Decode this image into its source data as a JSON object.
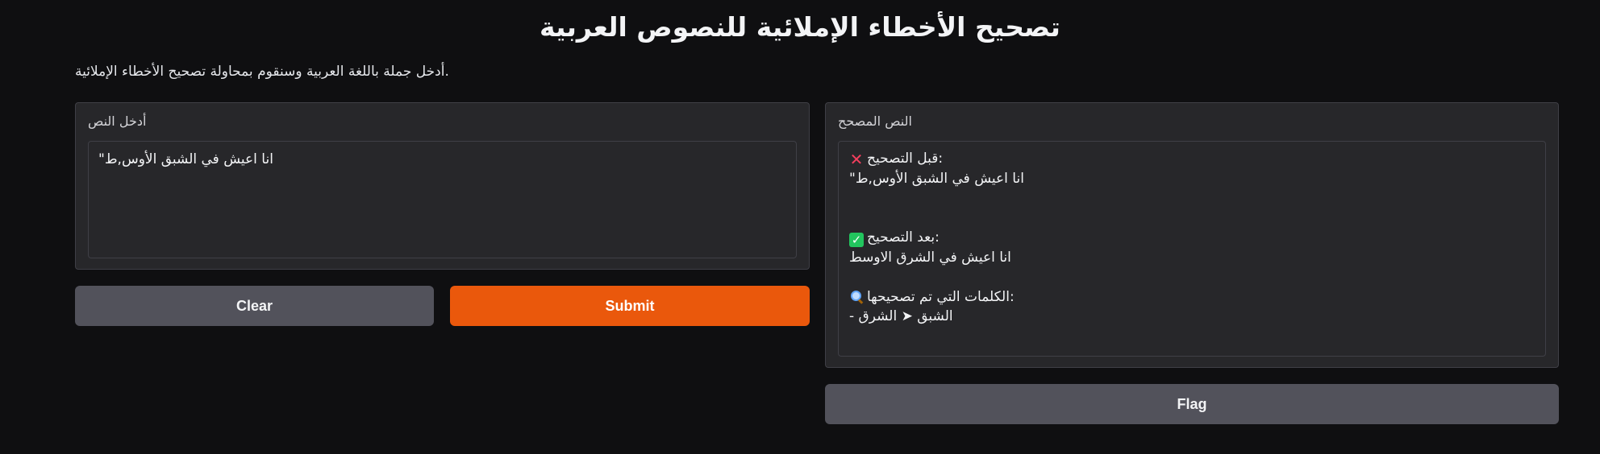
{
  "header": {
    "title": "تصحيح الأخطاء الإملائية للنصوص العربية",
    "description": "أدخل جملة باللغة العربية وسنقوم بمحاولة تصحيح الأخطاء الإملائية."
  },
  "input_panel": {
    "label": "أدخل النص",
    "value": "\"انا اعيش في الشبق الأوس,ط"
  },
  "output_panel": {
    "label": "النص المصحح",
    "before_icon": "cross-mark-icon",
    "before_label": "قبل التصحيح:",
    "before_text": "\"انا اعيش في الشبق الأوس,ط",
    "after_icon": "check-mark-icon",
    "after_label": "بعد التصحيح:",
    "after_text": "انا اعيش في الشرق الاوسط",
    "changes_icon": "magnifier-icon",
    "changes_label": "الكلمات التي تم تصحيحها:",
    "changes_item": "- الشبق ➤ الشرق"
  },
  "buttons": {
    "clear": "Clear",
    "submit": "Submit",
    "flag": "Flag"
  },
  "colors": {
    "background": "#0f0f11",
    "panel": "#27272a",
    "submit": "#ea580c",
    "secondary_button": "#52525b"
  }
}
